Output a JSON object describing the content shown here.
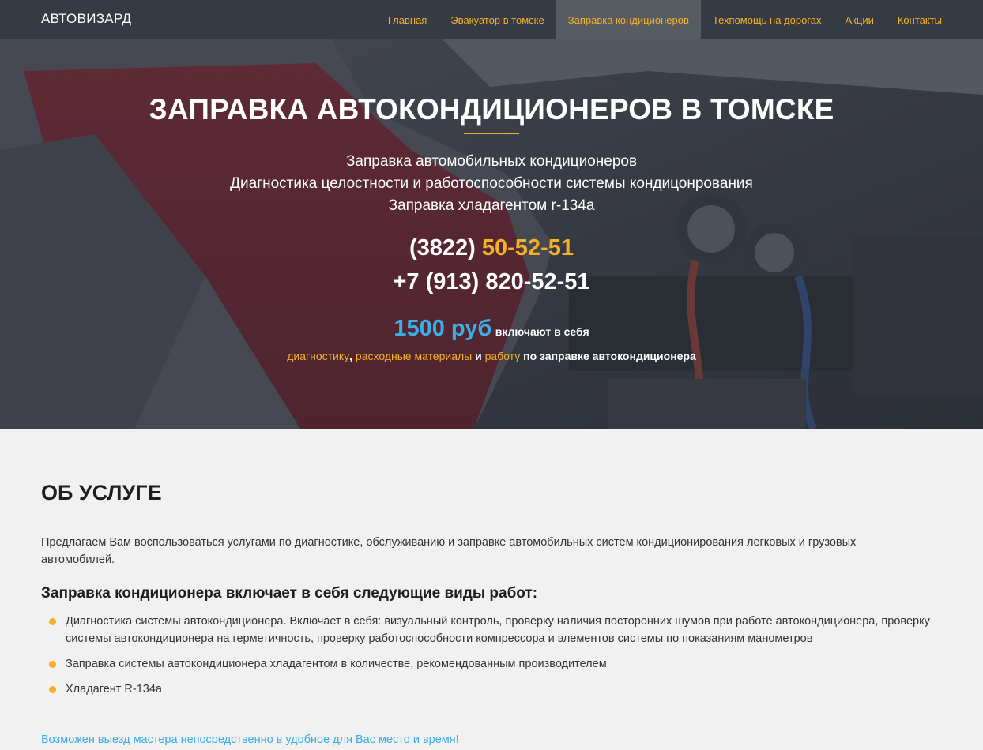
{
  "navbar": {
    "brand": "АВТОВИЗАРД",
    "items": [
      {
        "label": "Главная"
      },
      {
        "label": "Эвакуатор в томске"
      },
      {
        "label": "Заправка кондиционеров"
      },
      {
        "label": "Техпомощь на дорогах"
      },
      {
        "label": "Акции"
      },
      {
        "label": "Контакты"
      }
    ]
  },
  "hero": {
    "title": "ЗАПРАВКА АВТОКОНДИЦИОНЕРОВ В ТОМСКЕ",
    "lines": [
      "Заправка автомобильных кондиционеров",
      "Диагностика целостности и работоспособности системы кондицонрования",
      "Заправка хладагентом r-134a"
    ],
    "phone1_code": "(3822)",
    "phone1_number": "50-52-51",
    "phone2": "+7 (913) 820-52-51",
    "price": "1500 руб",
    "price_tail": "включают в себя",
    "includes": {
      "item1": "диагностику",
      "sep1": ", ",
      "item2": "расходные материалы",
      "sep2": " и ",
      "item3": "работу",
      "tail": " по заправке автокондиционера"
    }
  },
  "about": {
    "title": "ОБ УСЛУГЕ",
    "intro": "Предлагаем Вам воспользоваться услугами по диагностике, обслуживанию и заправке автомобильных систем кондиционирования легковых и грузовых автомобилей.",
    "subtitle": "Заправка кондиционера включает в себя следующие виды работ:",
    "works": [
      "Диагностика системы автокондиционера. Включает в себя: визуальный контроль, проверку наличия посторонних шумов при работе автокондиционера, проверку системы автокондиционера на герметичность, проверку работоспособности компрессора и элементов системы по показаниям манометров",
      "Заправка системы автокондиционера хладагентом в количестве, рекомендованным производителем",
      "Хладагент R-134a"
    ],
    "note": "Возможен выезд мастера непосредственно в удобное для Вас место и время!"
  },
  "colors": {
    "navbar_bg": "#363b43",
    "accent_yellow": "#f4b125",
    "accent_blue": "#3aaee5",
    "section_bg": "#f1f1f1"
  }
}
